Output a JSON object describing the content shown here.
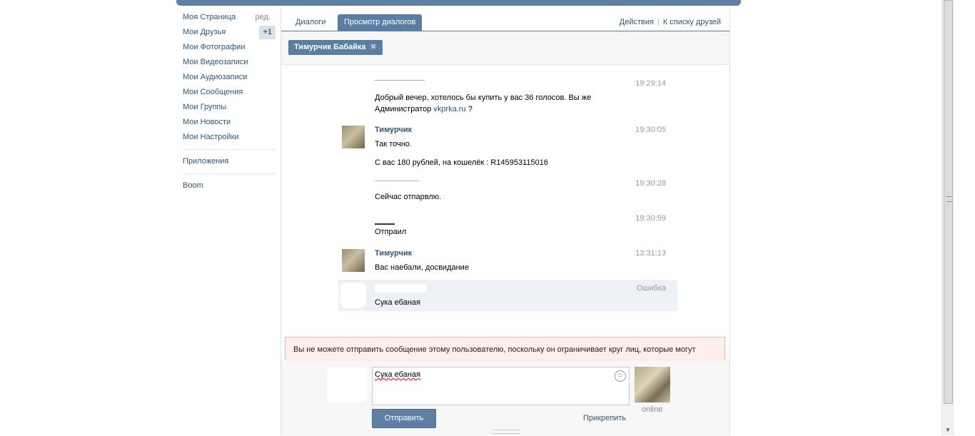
{
  "menu": {
    "items": [
      {
        "label": "Моя Страница",
        "extra": "ред."
      },
      {
        "label": "Мои Друзья",
        "badge": "+1"
      },
      {
        "label": "Мои Фотографии"
      },
      {
        "label": "Мои Видеозаписи"
      },
      {
        "label": "Мои Аудиозаписи"
      },
      {
        "label": "Мои Сообщения"
      },
      {
        "label": "Мои Группы"
      },
      {
        "label": "Мои Новости"
      },
      {
        "label": "Мои Настройки"
      }
    ],
    "apps": "Приложения",
    "boom": "Boom"
  },
  "tabs": {
    "dialogs": "Диалоги",
    "view": "Просмотр диалогов",
    "actions": "Действия",
    "separator": "|",
    "friends": "К списку друзей"
  },
  "filter": {
    "chip": "Тимурчик Бабайка",
    "remove_glyph": "✖"
  },
  "messages": [
    {
      "time": "19:29:14",
      "text_line1": "Добрый вечер, хотелось бы купить у вас 36 голосов. Вы же",
      "text_line2_prefix": "Администратор",
      "link": "vkprka.ru",
      "text_line2_suffix": "?"
    },
    {
      "author": "Тимурчик",
      "time": "19:30:05",
      "text": "Так точно.",
      "text2": "С вас 180 рублей, на кошелёк : R145953115016"
    },
    {
      "time": "19:30:28",
      "text": "Сейчас отпарвлю."
    },
    {
      "time": "19:30:59",
      "text": "Отпраил"
    },
    {
      "author": "Тимурчик",
      "time": "13:31:13",
      "text": "Вас наебали, досвидание"
    },
    {
      "time": "Ошибка",
      "text": "Сука ебаная"
    }
  ],
  "warning": "Вы не можете отправить сообщение этому пользователю, поскольку он ограничивает круг лиц, которые могут",
  "compose": {
    "text": "Сука ебаная",
    "send": "Отправить",
    "attach": "Прикрепить",
    "status": "online"
  },
  "colors": {
    "accent": "#597da3",
    "link": "#2b587a",
    "warning_bg": "#ffefe8",
    "error_row": "#edf0f5"
  }
}
